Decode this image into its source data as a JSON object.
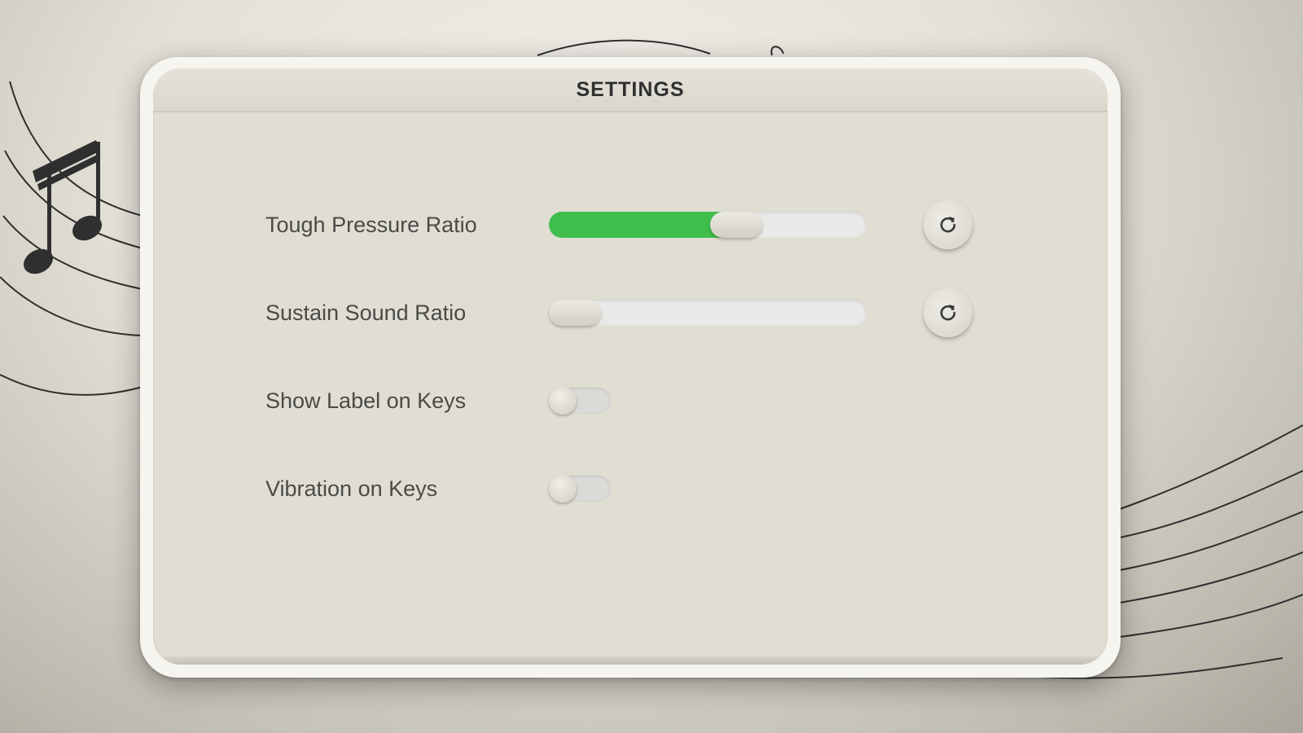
{
  "window": {
    "title": "SETTINGS"
  },
  "settings": {
    "items": [
      {
        "label": "Tough Pressure Ratio",
        "control": "slider",
        "value_fraction": 0.59
      },
      {
        "label": "Sustain Sound Ratio",
        "control": "slider",
        "value_fraction": 0.0
      },
      {
        "label": "Show Label on Keys",
        "control": "toggle",
        "on": false
      },
      {
        "label": "Vibration on Keys",
        "control": "toggle",
        "on": false
      }
    ]
  },
  "icons": {
    "reset": "reset-icon",
    "background_note": "music-note-icon"
  },
  "colors": {
    "slider_fill": "#3fbd4d",
    "panel": "#e0ddd2",
    "frame": "#f5f4ef",
    "text": "#4a4a48"
  }
}
